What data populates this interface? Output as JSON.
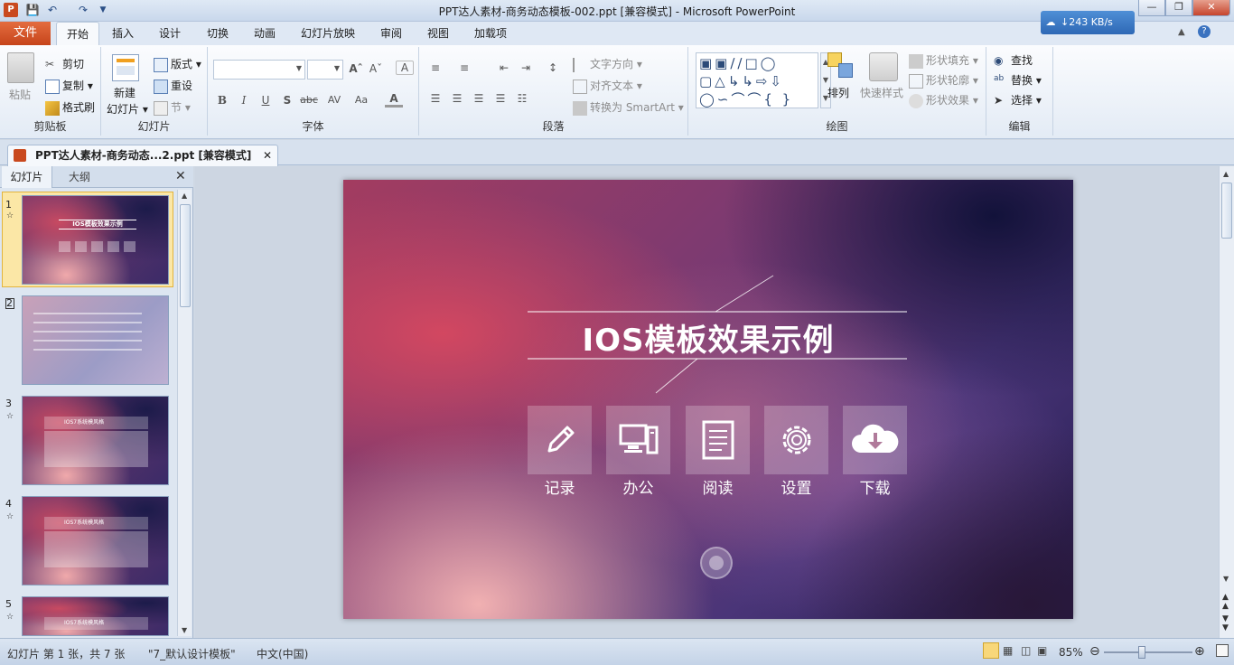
{
  "window": {
    "title": "PPT达人素材-商务动态模板-002.ppt [兼容模式]  -  Microsoft PowerPoint",
    "speed": "243 KB/s"
  },
  "tabs": {
    "file": "文件",
    "items": [
      "开始",
      "插入",
      "设计",
      "切换",
      "动画",
      "幻灯片放映",
      "审阅",
      "视图",
      "加载项"
    ]
  },
  "ribbon": {
    "clipboard": {
      "paste": "粘贴",
      "cut": "剪切",
      "copy": "复制",
      "format_painter": "格式刷",
      "label": "剪贴板"
    },
    "slides": {
      "new_slide": "新建",
      "new_slide2": "幻灯片",
      "layout": "版式",
      "reset": "重设",
      "section": "节",
      "label": "幻灯片"
    },
    "font": {
      "label": "字体"
    },
    "paragraph": {
      "text_direction": "文字方向",
      "align_text": "对齐文本",
      "smartart": "转换为 SmartArt",
      "label": "段落"
    },
    "drawing": {
      "arrange": "排列",
      "quick_styles": "快速样式",
      "shape_fill": "形状填充",
      "shape_outline": "形状轮廓",
      "shape_effects": "形状效果",
      "label": "绘图"
    },
    "editing": {
      "find": "查找",
      "replace": "替换",
      "select": "选择",
      "label": "编辑"
    }
  },
  "doc_tab": "PPT达人素材-商务动态...2.ppt [兼容模式]",
  "pane": {
    "tab_slides": "幻灯片",
    "tab_outline": "大纲",
    "thumb_title": "IOS模板效果示例",
    "thumb_heading": "IOS7系统模风格",
    "nums": [
      "1",
      "2",
      "3",
      "4",
      "5"
    ]
  },
  "slide": {
    "title": "IOS模板效果示例",
    "icons": [
      {
        "name": "pencil-icon",
        "label": "记录"
      },
      {
        "name": "computer-icon",
        "label": "办公"
      },
      {
        "name": "book-icon",
        "label": "阅读"
      },
      {
        "name": "gear-icon",
        "label": "设置"
      },
      {
        "name": "cloud-download-icon",
        "label": "下载"
      }
    ]
  },
  "status": {
    "slide_info": "幻灯片 第 1 张，共 7 张",
    "theme": "\"7_默认设计模板\"",
    "language": "中文(中国)",
    "zoom": "85%"
  }
}
